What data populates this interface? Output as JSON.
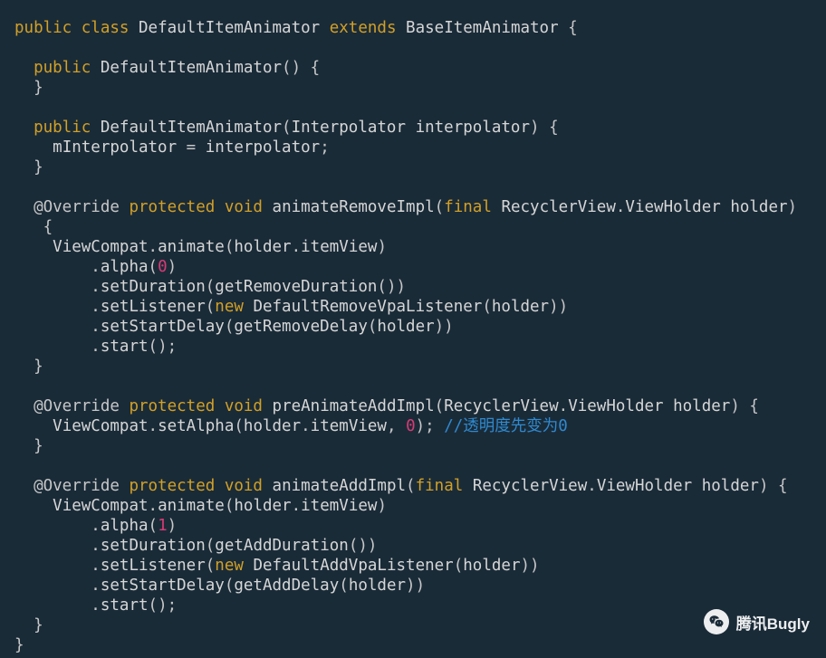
{
  "code": {
    "keywords": {
      "public": "public",
      "class": "class",
      "extends": "extends",
      "protected": "protected",
      "void": "void",
      "final": "final",
      "new": "new"
    },
    "identifiers": {
      "DefaultItemAnimator": "DefaultItemAnimator",
      "BaseItemAnimator": "BaseItemAnimator",
      "Interpolator": "Interpolator",
      "interpolator": "interpolator",
      "mInterpolator": "mInterpolator",
      "Override": "@Override",
      "animateRemoveImpl": "animateRemoveImpl",
      "RecyclerView": "RecyclerView",
      "ViewHolder": "ViewHolder",
      "holder": "holder",
      "ViewCompat": "ViewCompat",
      "animate": "animate",
      "itemView": "itemView",
      "alpha": "alpha",
      "setDuration": "setDuration",
      "getRemoveDuration": "getRemoveDuration",
      "setListener": "setListener",
      "DefaultRemoveVpaListener": "DefaultRemoveVpaListener",
      "setStartDelay": "setStartDelay",
      "getRemoveDelay": "getRemoveDelay",
      "start": "start",
      "preAnimateAddImpl": "preAnimateAddImpl",
      "setAlpha": "setAlpha",
      "animateAddImpl": "animateAddImpl",
      "getAddDuration": "getAddDuration",
      "DefaultAddVpaListener": "DefaultAddVpaListener",
      "getAddDelay": "getAddDelay"
    },
    "numbers": {
      "zero": "0",
      "one": "1"
    },
    "comment": "//透明度先变为0"
  },
  "watermark": {
    "text": "腾讯Bugly"
  }
}
